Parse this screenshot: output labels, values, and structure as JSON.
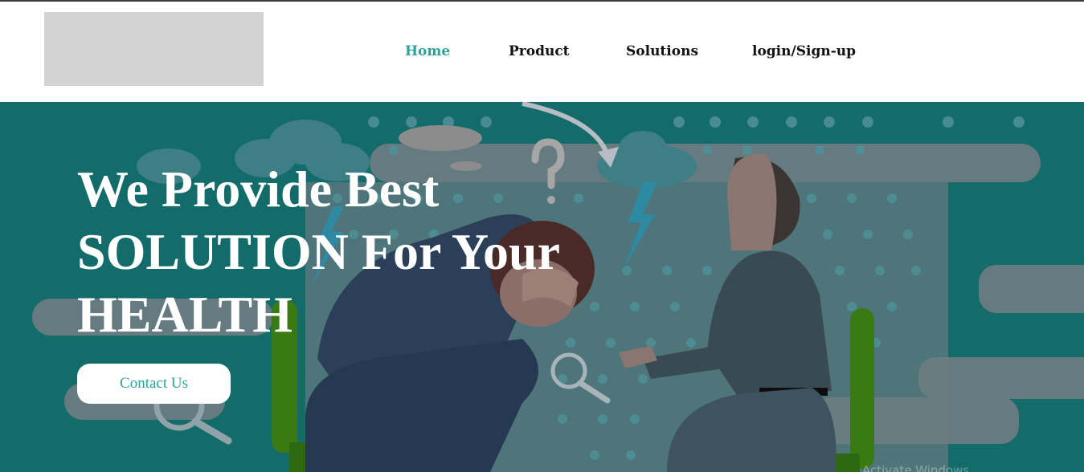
{
  "nav": {
    "items": [
      {
        "label": "Home",
        "active": true
      },
      {
        "label": "Product",
        "active": false
      },
      {
        "label": "Solutions",
        "active": false
      },
      {
        "label": "login/Sign-up",
        "active": false
      }
    ]
  },
  "hero": {
    "headline_lines": [
      "We Provide Best",
      "SOLUTION For Your",
      "HEALTH"
    ],
    "cta_label": "Contact Us",
    "watermark": "Activate Windows"
  },
  "colors": {
    "accent": "#2aa39a",
    "hero_bg": "#136b6a",
    "logo_placeholder": "#d3d3d3"
  }
}
